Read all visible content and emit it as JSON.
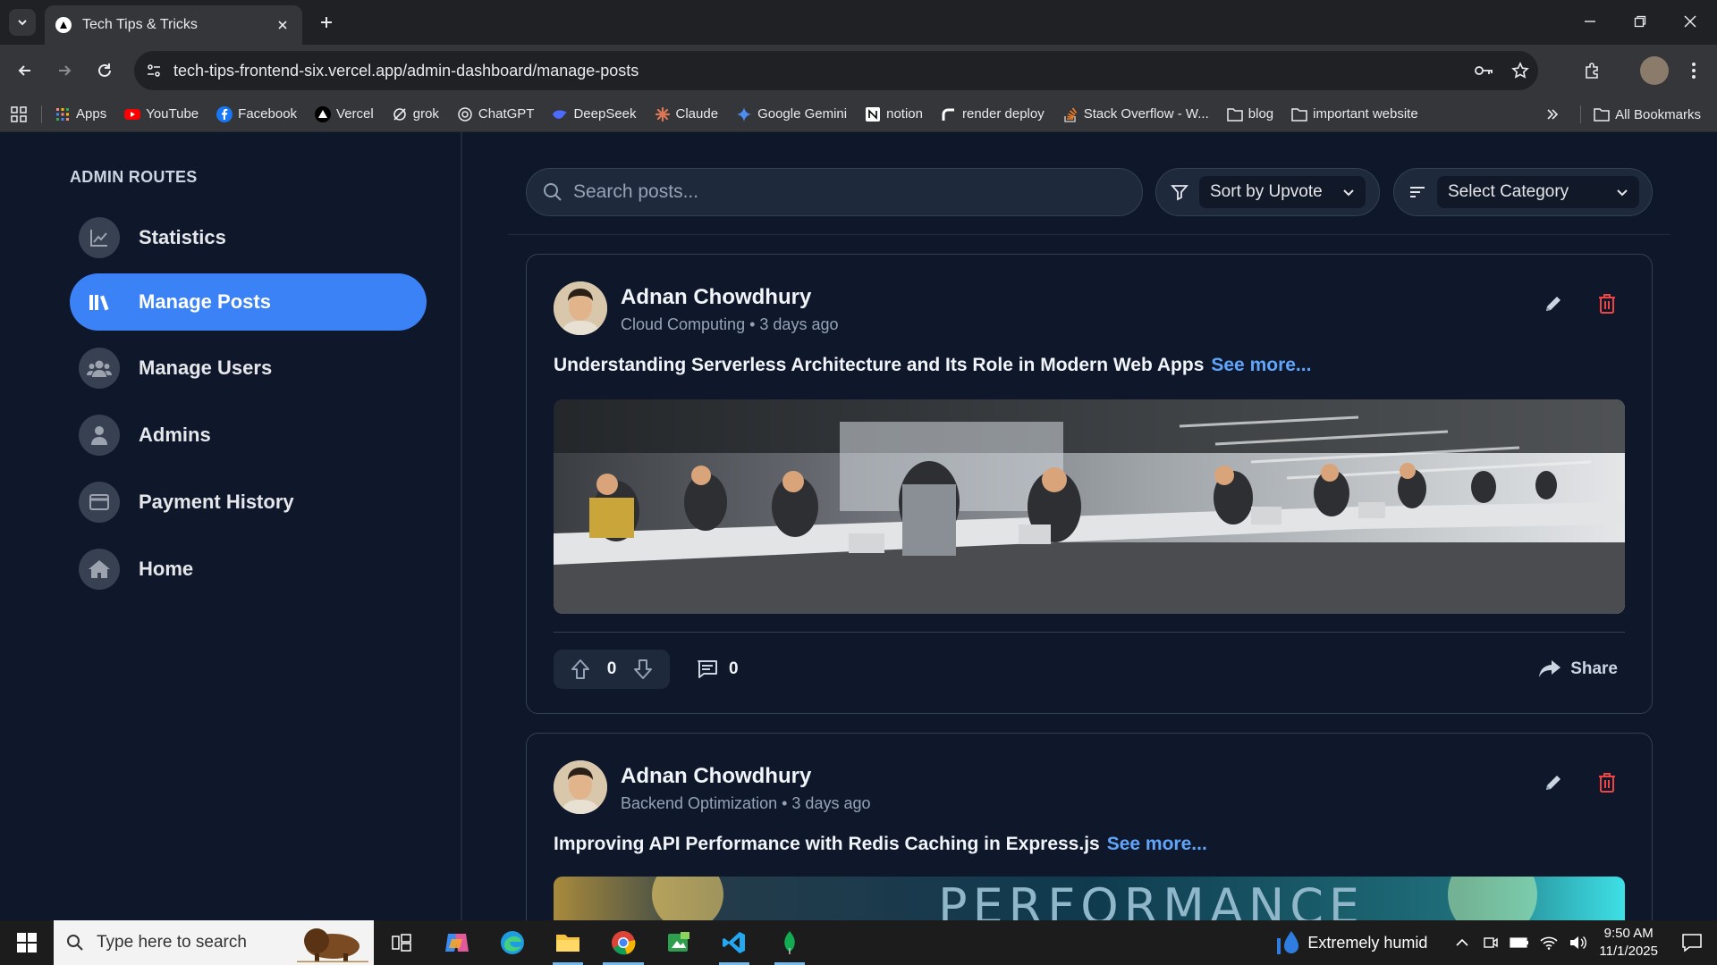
{
  "browser": {
    "tab_title": "Tech Tips & Tricks",
    "url": "tech-tips-frontend-six.vercel.app/admin-dashboard/manage-posts",
    "bookmarks": [
      {
        "label": "Apps",
        "icon": "apps-grid-icon"
      },
      {
        "label": "YouTube",
        "icon": "youtube-icon"
      },
      {
        "label": "Facebook",
        "icon": "facebook-icon"
      },
      {
        "label": "Vercel",
        "icon": "vercel-icon"
      },
      {
        "label": "grok",
        "icon": "grok-icon"
      },
      {
        "label": "ChatGPT",
        "icon": "chatgpt-icon"
      },
      {
        "label": "DeepSeek",
        "icon": "deepseek-icon"
      },
      {
        "label": "Claude",
        "icon": "claude-icon"
      },
      {
        "label": "Google Gemini",
        "icon": "gemini-icon"
      },
      {
        "label": "notion",
        "icon": "notion-icon"
      },
      {
        "label": "render deploy",
        "icon": "render-icon"
      },
      {
        "label": "Stack Overflow - W...",
        "icon": "stackoverflow-icon"
      },
      {
        "label": "blog",
        "icon": "folder-icon"
      },
      {
        "label": "important website",
        "icon": "folder-icon"
      }
    ],
    "all_bookmarks": "All Bookmarks"
  },
  "sidebar": {
    "heading": "ADMIN ROUTES",
    "items": [
      {
        "label": "Statistics",
        "icon": "chart-line-icon",
        "active": false
      },
      {
        "label": "Manage Posts",
        "icon": "books-icon",
        "active": true
      },
      {
        "label": "Manage Users",
        "icon": "users-icon",
        "active": false
      },
      {
        "label": "Admins",
        "icon": "user-icon",
        "active": false
      },
      {
        "label": "Payment History",
        "icon": "credit-card-icon",
        "active": false
      },
      {
        "label": "Home",
        "icon": "home-icon",
        "active": false
      }
    ]
  },
  "filters": {
    "search_placeholder": "Search posts...",
    "sort_selected": "Sort by Upvote",
    "category_selected": "Select Category"
  },
  "posts": [
    {
      "author": "Adnan Chowdhury",
      "category": "Cloud Computing",
      "time": "3 days ago",
      "title": "Understanding Serverless Architecture and Its Role in Modern Web Apps",
      "see_more": "See more...",
      "upvotes": "0",
      "comments": "0",
      "share": "Share"
    },
    {
      "author": "Adnan Chowdhury",
      "category": "Backend Optimization",
      "time": "3 days ago",
      "title": "Improving API Performance with Redis Caching in Express.js",
      "see_more": "See more...",
      "image_text": "PERFORMANCE"
    }
  ],
  "taskbar": {
    "search_placeholder": "Type here to search",
    "weather": "Extremely humid",
    "time": "9:50 AM",
    "date": "11/1/2025"
  },
  "colors": {
    "accent": "#3b82f6",
    "link": "#60a5fa",
    "danger": "#ef4444",
    "background": "#0f172a"
  }
}
